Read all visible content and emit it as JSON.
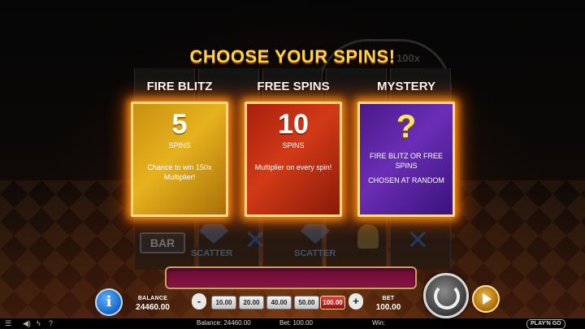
{
  "title": "CHOOSE YOUR SPINS!",
  "background": {
    "multiplier_text": "100x",
    "symbols": {
      "bar": "BAR",
      "scatter": "SCATTER"
    }
  },
  "options": [
    {
      "name": "FIRE BLITZ",
      "number": "5",
      "unit": "SPINS",
      "description": "Chance to win 150x Multiplier!",
      "color": "#e6b21e"
    },
    {
      "name": "FREE SPINS",
      "number": "10",
      "unit": "SPINS",
      "description": "Multiplier on every spin!",
      "color": "#d23a16"
    },
    {
      "name": "MYSTERY",
      "symbol": "?",
      "description": "FIRE BLITZ OR FREE SPINS",
      "description2": "CHOSEN AT RANDOM",
      "color": "#6a2eb6"
    }
  ],
  "controls": {
    "info_label": "i",
    "balance_label": "BALANCE",
    "balance_value": "24460.00",
    "bet_label": "BET",
    "bet_value": "100.00",
    "minus_label": "-",
    "plus_label": "+",
    "bet_options": [
      "10.00",
      "20.00",
      "40.00",
      "50.00",
      "100.00"
    ],
    "selected_bet": "100.00",
    "spin_icon": "spin-arrows-icon",
    "autoplay_icon": "autoplay-play-icon"
  },
  "statusbar": {
    "balance": "Balance: 24460.00",
    "bet": "Bet: 100.00",
    "win": "Win:",
    "logo": "PLAY'N GO"
  }
}
